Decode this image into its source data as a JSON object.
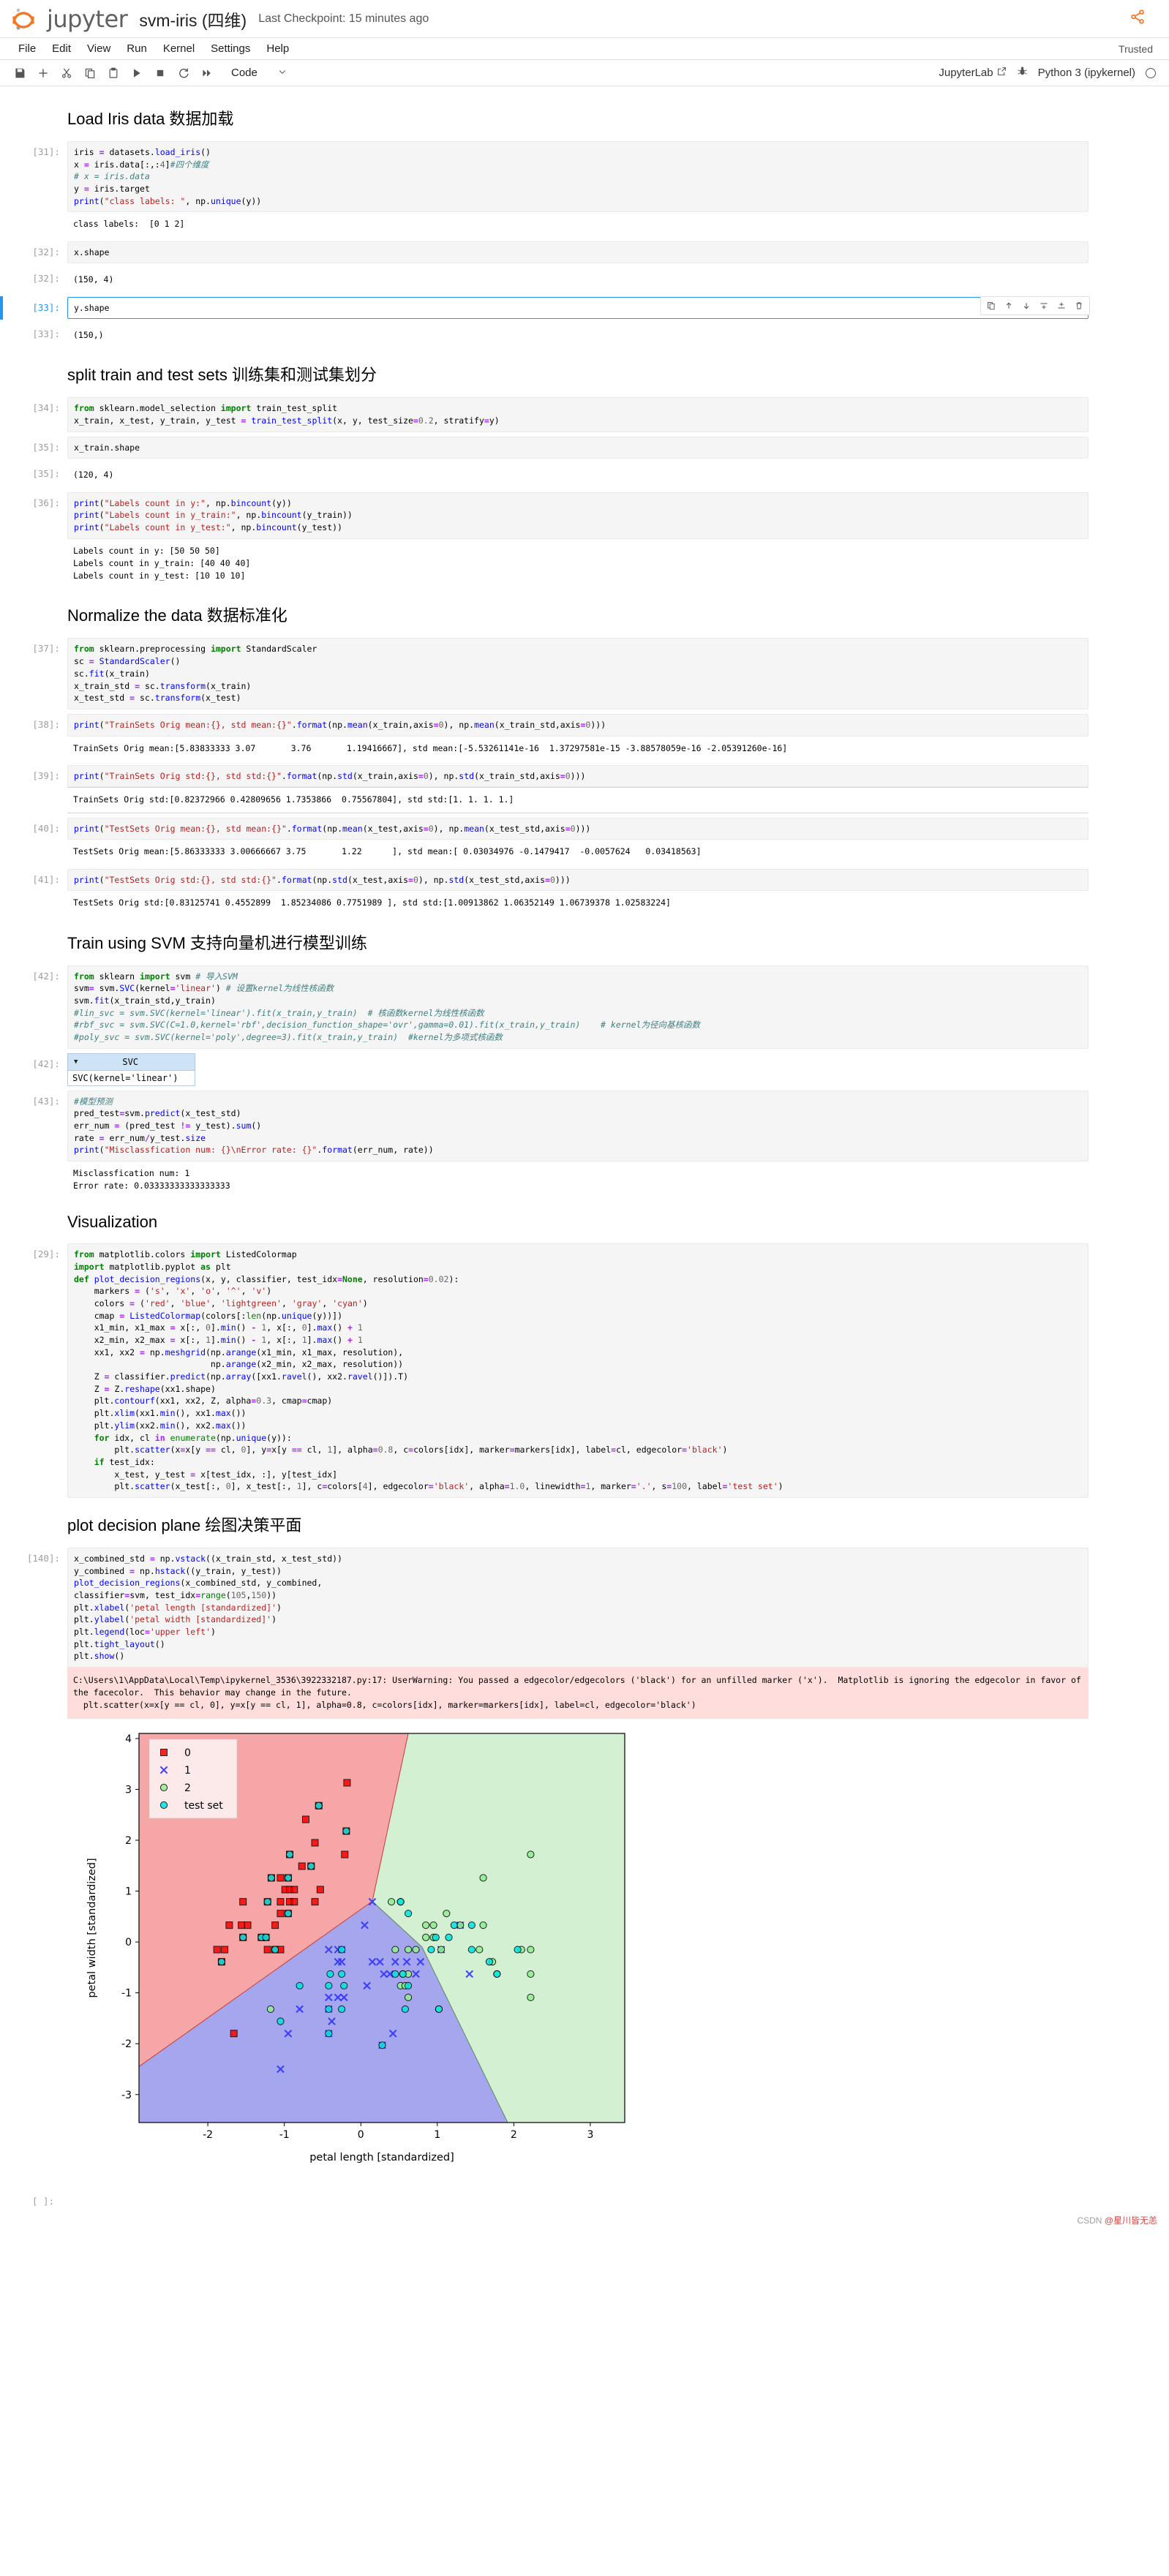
{
  "header": {
    "brand": "jupyter",
    "notebook_title": "svm-iris (四维)",
    "checkpoint": "Last Checkpoint: 15 minutes ago",
    "logo_icon": "jupyter-logo-icon",
    "share_icon": "share-icon"
  },
  "menubar": {
    "items": [
      "File",
      "Edit",
      "View",
      "Run",
      "Kernel",
      "Settings",
      "Help"
    ],
    "trusted": "Trusted"
  },
  "toolbar": {
    "buttons": [
      {
        "name": "save-icon",
        "glyph": "save"
      },
      {
        "name": "add-cell-icon",
        "glyph": "plus"
      },
      {
        "name": "cut-icon",
        "glyph": "scissors"
      },
      {
        "name": "copy-icon",
        "glyph": "copy"
      },
      {
        "name": "paste-icon",
        "glyph": "paste"
      },
      {
        "name": "run-icon",
        "glyph": "play"
      },
      {
        "name": "stop-icon",
        "glyph": "square"
      },
      {
        "name": "restart-icon",
        "glyph": "refresh"
      },
      {
        "name": "restart-run-all-icon",
        "glyph": "forward"
      }
    ],
    "cell_type": "Code",
    "jupyterlab_label": "JupyterLab",
    "kernel_name": "Python 3 (ipykernel)",
    "kernel_status": "idle"
  },
  "cell_toolbar": {
    "duplicate": "duplicate-icon",
    "move_up": "move-up-icon",
    "move_down": "move-down-icon",
    "insert_above": "insert-above-icon",
    "insert_below": "insert-below-icon",
    "delete": "delete-icon"
  },
  "cells": {
    "h1": "Load Iris data 数据加载",
    "c31_prompt": "[31]:",
    "c31_out_prompt": "",
    "c31_out": "class labels:  [0 1 2]",
    "c32_prompt": "[32]:",
    "c32_code": "x.shape",
    "c32_out_prompt": "[32]:",
    "c32_out": "(150, 4)",
    "c33_prompt": "[33]:",
    "c33_code": "y.shape",
    "c33_out_prompt": "[33]:",
    "c33_out": "(150,)",
    "h2": "split train and test sets 训练集和测试集划分",
    "c34_prompt": "[34]:",
    "c35_prompt": "[35]:",
    "c35_code": "x_train.shape",
    "c35_out_prompt": "[35]:",
    "c35_out": "(120, 4)",
    "c36_prompt": "[36]:",
    "c36_out": "Labels count in y: [50 50 50]\nLabels count in y_train: [40 40 40]\nLabels count in y_test: [10 10 10]",
    "h3": "Normalize the data 数据标准化",
    "c37_prompt": "[37]:",
    "c38_prompt": "[38]:",
    "c38_out": "TrainSets Orig mean:[5.83833333 3.07       3.76       1.19416667], std mean:[-5.53261141e-16  1.37297581e-15 -3.88578059e-16 -2.05391260e-16]",
    "c39_prompt": "[39]:",
    "c39_out": "TrainSets Orig std:[0.82372966 0.42809656 1.7353866  0.75567804], std std:[1. 1. 1. 1.]",
    "c40_prompt": "[40]:",
    "c40_out": "TestSets Orig mean:[5.86333333 3.00666667 3.75       1.22      ], std mean:[ 0.03034976 -0.1479417  -0.0057624   0.03418563]",
    "c41_prompt": "[41]:",
    "c41_out": "TestSets Orig std:[0.83125741 0.4552899  1.85234086 0.7751989 ], std std:[1.00913862 1.06352149 1.06739378 1.02583224]",
    "h4": "Train using SVM 支持向量机进行模型训练",
    "c42_prompt": "[42]:",
    "c42_out_prompt": "[42]:",
    "svc_title": "SVC",
    "svc_repr": "SVC(kernel='linear')",
    "c43_prompt": "[43]:",
    "c43_out": "Misclassfication num: 1\nError rate: 0.03333333333333333",
    "h5": "Visualization",
    "c29_prompt": "[29]:",
    "h6": "plot decision plane 绘图决策平面",
    "c140_prompt": "[140]:",
    "warning_out": "C:\\Users\\1\\AppData\\Local\\Temp\\ipykernel_3536\\3922332187.py:17: UserWarning: You passed a edgecolor/edgecolors ('black') for an unfilled marker ('x').  Matplotlib is ignoring the edgecolor in favor of the facecolor.  This behavior may change in the future.\n  plt.scatter(x=x[y == cl, 0], y=x[y == cl, 1], alpha=0.8, c=colors[idx], marker=markers[idx], label=cl, edgecolor='black')",
    "empty_prompt": "[ ]:"
  },
  "chart_data": {
    "type": "scatter",
    "title": "",
    "xlabel": "petal length [standardized]",
    "ylabel": "petal width [standardized]",
    "xlim": [
      -2.9,
      3.45
    ],
    "ylim": [
      -3.55,
      4.1
    ],
    "xticks": [
      -2,
      -1,
      0,
      1,
      2,
      3
    ],
    "yticks": [
      -3,
      -2,
      -1,
      0,
      1,
      2,
      3,
      4
    ],
    "grid": false,
    "legend_position": "upper left",
    "legend": [
      {
        "label": "0",
        "marker": "square",
        "color": "#ff0000"
      },
      {
        "label": "1",
        "marker": "x",
        "color": "#3333ff"
      },
      {
        "label": "2",
        "marker": "circle",
        "color": "#90ee90"
      },
      {
        "label": "test set",
        "marker": "circle",
        "color": "#00e5e5"
      }
    ],
    "regions": [
      {
        "name": "class-0-region",
        "color": "#f6a6a6"
      },
      {
        "name": "class-1-region",
        "color": "#a6a6ef"
      },
      {
        "name": "class-2-region",
        "color": "#d3f0d3"
      }
    ],
    "series": [
      {
        "name": "0",
        "marker": "square",
        "color": "#ff0000",
        "points": [
          [
            -0.18,
            3.13
          ],
          [
            -0.55,
            2.68
          ],
          [
            -0.72,
            2.41
          ],
          [
            -0.19,
            2.18
          ],
          [
            -0.6,
            1.95
          ],
          [
            -0.21,
            1.72
          ],
          [
            -0.93,
            1.72
          ],
          [
            -0.77,
            1.49
          ],
          [
            -0.65,
            1.49
          ],
          [
            -1.17,
            1.26
          ],
          [
            -1.05,
            1.26
          ],
          [
            -0.95,
            1.26
          ],
          [
            -0.53,
            1.03
          ],
          [
            -0.99,
            1.03
          ],
          [
            -0.93,
            1.03
          ],
          [
            -0.87,
            1.03
          ],
          [
            -1.54,
            0.79
          ],
          [
            -1.22,
            0.79
          ],
          [
            -1.05,
            0.79
          ],
          [
            -0.93,
            0.79
          ],
          [
            -0.87,
            0.79
          ],
          [
            -0.6,
            0.79
          ],
          [
            -0.95,
            0.56
          ],
          [
            -1.05,
            0.56
          ],
          [
            -1.72,
            0.33
          ],
          [
            -1.56,
            0.33
          ],
          [
            -1.48,
            0.33
          ],
          [
            -1.12,
            0.33
          ],
          [
            -1.54,
            0.09
          ],
          [
            -1.3,
            0.09
          ],
          [
            -1.24,
            0.09
          ],
          [
            -1.88,
            -0.15
          ],
          [
            -1.78,
            -0.15
          ],
          [
            -1.22,
            -0.15
          ],
          [
            -1.12,
            -0.15
          ],
          [
            -1.05,
            -0.15
          ],
          [
            -1.82,
            -0.39
          ],
          [
            -1.66,
            -1.8
          ]
        ]
      },
      {
        "name": "1",
        "marker": "x",
        "color": "#3333ff",
        "points": [
          [
            0.15,
            0.79
          ],
          [
            0.05,
            0.33
          ],
          [
            -0.42,
            -0.15
          ],
          [
            -0.3,
            -0.15
          ],
          [
            -0.25,
            -0.15
          ],
          [
            -0.3,
            -0.39
          ],
          [
            -0.25,
            -0.39
          ],
          [
            0.15,
            -0.39
          ],
          [
            0.25,
            -0.39
          ],
          [
            0.45,
            -0.39
          ],
          [
            0.6,
            -0.39
          ],
          [
            0.78,
            -0.39
          ],
          [
            1.05,
            -0.15
          ],
          [
            1.3,
            0.33
          ],
          [
            0.3,
            -0.63
          ],
          [
            0.72,
            -0.63
          ],
          [
            1.42,
            -0.63
          ],
          [
            0.08,
            -0.86
          ],
          [
            -0.42,
            -1.09
          ],
          [
            -0.3,
            -1.09
          ],
          [
            -0.22,
            -1.09
          ],
          [
            -0.8,
            -1.32
          ],
          [
            -0.42,
            -1.32
          ],
          [
            -0.95,
            -1.8
          ],
          [
            -0.42,
            -1.8
          ],
          [
            0.42,
            -1.8
          ],
          [
            0.28,
            -2.03
          ],
          [
            -1.05,
            -2.5
          ],
          [
            -0.38,
            -1.56
          ],
          [
            0.38,
            -0.63
          ]
        ]
      },
      {
        "name": "2",
        "marker": "circle",
        "color": "#90ee90",
        "points": [
          [
            2.22,
            1.72
          ],
          [
            1.6,
            1.26
          ],
          [
            1.12,
            0.56
          ],
          [
            0.85,
            0.33
          ],
          [
            0.95,
            0.33
          ],
          [
            1.3,
            0.33
          ],
          [
            1.6,
            0.33
          ],
          [
            0.85,
            0.09
          ],
          [
            0.4,
            0.79
          ],
          [
            0.52,
            0.79
          ],
          [
            0.45,
            -0.15
          ],
          [
            0.62,
            -0.15
          ],
          [
            0.72,
            -0.15
          ],
          [
            1.05,
            -0.15
          ],
          [
            1.55,
            -0.15
          ],
          [
            2.1,
            -0.15
          ],
          [
            2.22,
            -0.15
          ],
          [
            1.72,
            -0.39
          ],
          [
            0.55,
            -0.63
          ],
          [
            0.62,
            -0.63
          ],
          [
            1.78,
            -0.63
          ],
          [
            2.22,
            -0.63
          ],
          [
            2.22,
            -1.09
          ],
          [
            0.62,
            -1.09
          ],
          [
            1.02,
            -1.32
          ],
          [
            -1.18,
            -1.32
          ],
          [
            0.52,
            -0.86
          ],
          [
            0.58,
            -0.86
          ],
          [
            0.95,
            0.09
          ]
        ]
      },
      {
        "name": "test set",
        "marker": "circle",
        "color": "#00e5e5",
        "points": [
          [
            -0.55,
            2.68
          ],
          [
            -0.19,
            2.18
          ],
          [
            -0.93,
            1.72
          ],
          [
            -0.65,
            1.49
          ],
          [
            -1.17,
            1.26
          ],
          [
            -0.95,
            1.26
          ],
          [
            -1.22,
            0.79
          ],
          [
            -0.95,
            0.56
          ],
          [
            -1.54,
            0.09
          ],
          [
            -1.3,
            0.09
          ],
          [
            -1.24,
            0.09
          ],
          [
            -1.12,
            -0.15
          ],
          [
            -1.82,
            -0.39
          ],
          [
            0.52,
            0.79
          ],
          [
            0.62,
            0.56
          ],
          [
            1.22,
            0.33
          ],
          [
            1.45,
            0.33
          ],
          [
            0.98,
            0.09
          ],
          [
            1.15,
            0.09
          ],
          [
            -0.25,
            -0.15
          ],
          [
            0.92,
            -0.15
          ],
          [
            1.45,
            -0.15
          ],
          [
            2.05,
            -0.15
          ],
          [
            1.68,
            -0.39
          ],
          [
            -0.4,
            -0.63
          ],
          [
            -0.25,
            -0.63
          ],
          [
            0.45,
            -0.63
          ],
          [
            0.55,
            -0.63
          ],
          [
            1.78,
            -0.63
          ],
          [
            -0.8,
            -0.86
          ],
          [
            -0.42,
            -0.86
          ],
          [
            -0.22,
            -0.86
          ],
          [
            0.62,
            -0.86
          ],
          [
            -0.42,
            -1.32
          ],
          [
            -0.25,
            -1.32
          ],
          [
            0.58,
            -1.32
          ],
          [
            1.02,
            -1.32
          ],
          [
            -1.05,
            -1.56
          ],
          [
            -0.42,
            -1.8
          ],
          [
            0.28,
            -2.03
          ]
        ]
      }
    ]
  },
  "watermark": {
    "prefix": "CSDN ",
    "at": "@",
    "name": "星川皆无恙"
  }
}
